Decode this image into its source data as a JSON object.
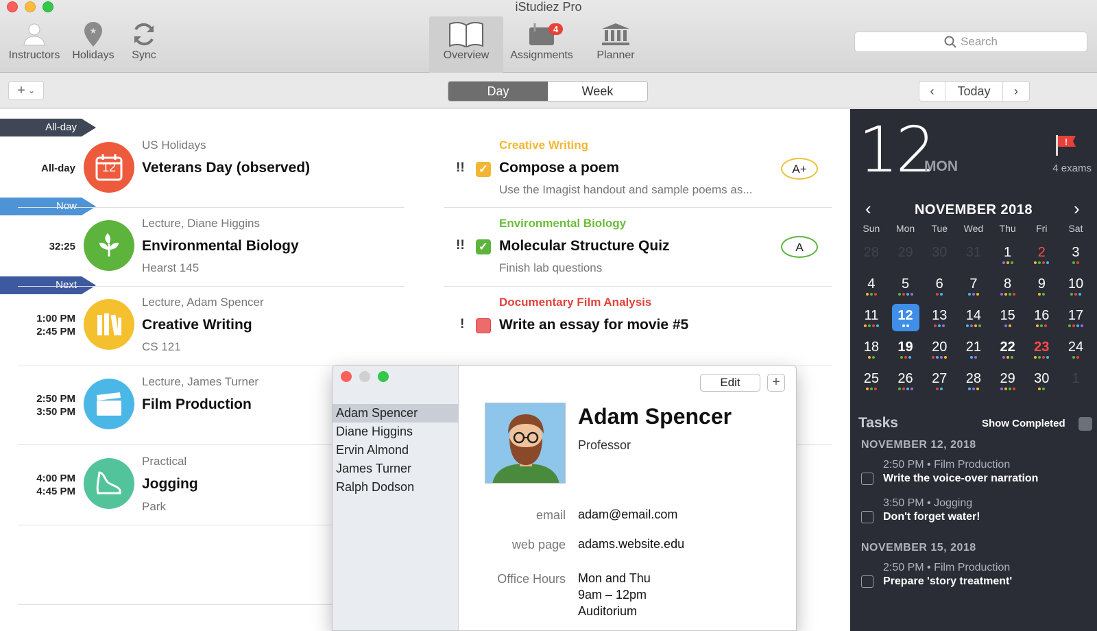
{
  "window": {
    "title": "iStudiez Pro"
  },
  "toolbar": {
    "instructors": "Instructors",
    "holidays": "Holidays",
    "sync": "Sync",
    "overview": "Overview",
    "assignments": "Assignments",
    "assignments_badge": "4",
    "planner": "Planner",
    "search_placeholder": "Search"
  },
  "subbar": {
    "add": "+",
    "day": "Day",
    "week": "Week",
    "today": "Today"
  },
  "flags": {
    "allday": "All-day",
    "now": "Now",
    "next": "Next"
  },
  "events": [
    {
      "time": "All-day",
      "subtitle": "US Holidays",
      "title": "Veterans Day (observed)",
      "detail": "",
      "icon": "calendar-icon",
      "color": "#ee5a3c",
      "cal_num": "12"
    },
    {
      "time": "32:25",
      "subtitle": "Lecture, Diane Higgins",
      "title": "Environmental Biology",
      "detail": "Hearst 145",
      "icon": "leaf-icon",
      "color": "#5cb43d"
    },
    {
      "time_start": "1:00 PM",
      "time_end": "2:45 PM",
      "subtitle": "Lecture, Adam Spencer",
      "title": "Creative Writing",
      "detail": "CS 121",
      "icon": "books-icon",
      "color": "#f4c02e"
    },
    {
      "time_start": "2:50 PM",
      "time_end": "3:50 PM",
      "subtitle": "Lecture, James Turner",
      "title": "Film Production",
      "detail": "",
      "icon": "clapperboard-icon",
      "color": "#4ab7e6"
    },
    {
      "time_start": "4:00 PM",
      "time_end": "4:45 PM",
      "subtitle": "Practical",
      "title": "Jogging",
      "detail": "Park",
      "icon": "sneaker-icon",
      "color": "#52c39a"
    }
  ],
  "assignments": [
    {
      "course": "Creative Writing",
      "course_color": "#f2b632",
      "priority": "!!",
      "title": "Compose a poem",
      "note": "Use the Imagist handout and sample poems as...",
      "checked": true,
      "grade": "A+",
      "grade_color": "#e9c43a"
    },
    {
      "course": "Environmental Biology",
      "course_color": "#6bbd39",
      "priority": "!!",
      "title": "Molecular Structure Quiz",
      "note": "Finish lab questions",
      "checked": true,
      "grade": "A",
      "grade_color": "#5cb43d"
    },
    {
      "course": "Documentary Film Analysis",
      "course_color": "#e0443c",
      "priority": "!",
      "title": "Write an essay for movie #5",
      "note": "",
      "checked": false
    }
  ],
  "sidepanel": {
    "day_number": "12",
    "day_name": "MON",
    "exams": "4 exams",
    "month": "NOVEMBER 2018",
    "weekdays": [
      "Sun",
      "Mon",
      "Tue",
      "Wed",
      "Thu",
      "Fri",
      "Sat"
    ],
    "weeks": [
      [
        {
          "d": "28",
          "o": true
        },
        {
          "d": "29",
          "o": true
        },
        {
          "d": "30",
          "o": true
        },
        {
          "d": "31",
          "o": true
        },
        {
          "d": "1"
        },
        {
          "d": "2",
          "red": true
        },
        {
          "d": "3"
        }
      ],
      [
        {
          "d": "4"
        },
        {
          "d": "5"
        },
        {
          "d": "6"
        },
        {
          "d": "7"
        },
        {
          "d": "8"
        },
        {
          "d": "9"
        },
        {
          "d": "10"
        }
      ],
      [
        {
          "d": "11"
        },
        {
          "d": "12",
          "sel": true
        },
        {
          "d": "13"
        },
        {
          "d": "14"
        },
        {
          "d": "15"
        },
        {
          "d": "16"
        },
        {
          "d": "17"
        }
      ],
      [
        {
          "d": "18"
        },
        {
          "d": "19",
          "bold": true
        },
        {
          "d": "20"
        },
        {
          "d": "21"
        },
        {
          "d": "22",
          "bold": true
        },
        {
          "d": "23",
          "red": true,
          "bold": true
        },
        {
          "d": "24"
        }
      ],
      [
        {
          "d": "25"
        },
        {
          "d": "26"
        },
        {
          "d": "27"
        },
        {
          "d": "28"
        },
        {
          "d": "29"
        },
        {
          "d": "30"
        },
        {
          "d": "1",
          "o": true
        }
      ]
    ],
    "tasks_heading": "Tasks",
    "show_completed": "Show Completed",
    "task_groups": [
      {
        "date": "NOVEMBER 12, 2018",
        "items": [
          {
            "meta": "2:50 PM • Film Production",
            "title": "Write the voice-over narration"
          },
          {
            "meta": "3:50 PM • Jogging",
            "title": "Don't forget water!"
          }
        ]
      },
      {
        "date": "NOVEMBER 15, 2018",
        "items": [
          {
            "meta": "2:50 PM • Film Production",
            "title": "Prepare 'story treatment'"
          }
        ]
      }
    ]
  },
  "popup": {
    "instructors": [
      "Adam Spencer",
      "Diane Higgins",
      "Ervin Almond",
      "James Turner",
      "Ralph Dodson"
    ],
    "edit": "Edit",
    "plus": "+",
    "name": "Adam Spencer",
    "role": "Professor",
    "email_label": "email",
    "email": "adam@email.com",
    "web_label": "web page",
    "web": "adams.website.edu",
    "hours_label": "Office Hours",
    "hours": [
      "Mon and Thu",
      "9am – 12pm",
      "Auditorium"
    ]
  }
}
